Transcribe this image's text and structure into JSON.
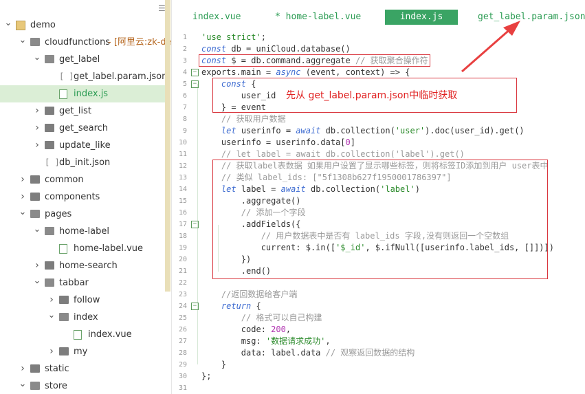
{
  "sidebar": {
    "menu_icon": "hamburger-icon",
    "items": [
      {
        "label": "demo",
        "type": "project",
        "depth": 0,
        "expanded": true
      },
      {
        "label": "cloudfunctions",
        "suffix": "- [阿里云:zk-dem",
        "type": "folder",
        "depth": 1,
        "expanded": true
      },
      {
        "label": "get_label",
        "type": "folder",
        "depth": 2,
        "expanded": true
      },
      {
        "label": "get_label.param.json",
        "type": "json",
        "depth": 3
      },
      {
        "label": "index.js",
        "type": "js",
        "depth": 3,
        "selected": true
      },
      {
        "label": "get_list",
        "type": "folder",
        "depth": 2,
        "expanded": false
      },
      {
        "label": "get_search",
        "type": "folder",
        "depth": 2,
        "expanded": false
      },
      {
        "label": "update_like",
        "type": "folder",
        "depth": 2,
        "expanded": false
      },
      {
        "label": "db_init.json",
        "type": "json",
        "depth": 2
      },
      {
        "label": "common",
        "type": "folder",
        "depth": 1,
        "expanded": false
      },
      {
        "label": "components",
        "type": "folder",
        "depth": 1,
        "expanded": false
      },
      {
        "label": "pages",
        "type": "folder",
        "depth": 1,
        "expanded": true
      },
      {
        "label": "home-label",
        "type": "folder",
        "depth": 2,
        "expanded": true
      },
      {
        "label": "home-label.vue",
        "type": "vue",
        "depth": 3
      },
      {
        "label": "home-search",
        "type": "folder",
        "depth": 2,
        "expanded": false
      },
      {
        "label": "tabbar",
        "type": "folder",
        "depth": 2,
        "expanded": true
      },
      {
        "label": "follow",
        "type": "folder",
        "depth": 3,
        "expanded": false
      },
      {
        "label": "index",
        "type": "folder",
        "depth": 3,
        "expanded": true
      },
      {
        "label": "index.vue",
        "type": "vue",
        "depth": 4
      },
      {
        "label": "my",
        "type": "folder",
        "depth": 3,
        "expanded": false
      },
      {
        "label": "static",
        "type": "folder",
        "depth": 1,
        "expanded": false
      },
      {
        "label": "store",
        "type": "folder",
        "depth": 1,
        "expanded": true
      }
    ]
  },
  "tabs": [
    {
      "label": "index.vue",
      "active": false
    },
    {
      "label": "* home-label.vue",
      "active": false
    },
    {
      "label": "index.js",
      "active": true
    },
    {
      "label": "get_label.param.json",
      "active": false
    }
  ],
  "editor": {
    "lines": [
      {
        "n": "1",
        "fold": null,
        "tokens": [
          [
            "s",
            "'use strict'"
          ],
          [
            "t",
            ";"
          ]
        ]
      },
      {
        "n": "2",
        "fold": null,
        "tokens": [
          [
            "k",
            "const"
          ],
          [
            "t",
            " db = uniCloud.database()"
          ]
        ]
      },
      {
        "n": "3",
        "fold": null,
        "tokens": [
          [
            "k",
            "const"
          ],
          [
            "t",
            " $ = db.command.aggregate "
          ],
          [
            "c",
            "// 获取聚合操作符"
          ]
        ]
      },
      {
        "n": "4",
        "fold": "-",
        "tokens": [
          [
            "t",
            "exports.main = "
          ],
          [
            "k",
            "async"
          ],
          [
            "t",
            " (event, context) => {"
          ]
        ]
      },
      {
        "n": "5",
        "fold": "-",
        "tokens": [
          [
            "t",
            "    "
          ],
          [
            "k",
            "const"
          ],
          [
            "t",
            " {"
          ]
        ]
      },
      {
        "n": "6",
        "fold": null,
        "tokens": [
          [
            "t",
            "        user_id"
          ]
        ]
      },
      {
        "n": "7",
        "fold": null,
        "tokens": [
          [
            "t",
            "    } = event"
          ]
        ]
      },
      {
        "n": "8",
        "fold": null,
        "tokens": [
          [
            "c",
            "    // 获取用户数据"
          ]
        ]
      },
      {
        "n": "9",
        "fold": null,
        "tokens": [
          [
            "t",
            "    "
          ],
          [
            "k",
            "let"
          ],
          [
            "t",
            " userinfo = "
          ],
          [
            "k",
            "await"
          ],
          [
            "t",
            " db.collection("
          ],
          [
            "s",
            "'user'"
          ],
          [
            "t",
            ").doc(user_id).get()"
          ]
        ]
      },
      {
        "n": "10",
        "fold": null,
        "tokens": [
          [
            "t",
            "    userinfo = userinfo.data["
          ],
          [
            "n",
            "0"
          ],
          [
            "t",
            "]"
          ]
        ]
      },
      {
        "n": "11",
        "fold": null,
        "tokens": [
          [
            "c",
            "    // let label = await db.collection('label').get()"
          ]
        ]
      },
      {
        "n": "12",
        "fold": null,
        "tokens": [
          [
            "c",
            "    // 获取label表数据 如果用户设置了显示哪些标签，则将标签ID添加到用户 user表中"
          ]
        ]
      },
      {
        "n": "13",
        "fold": null,
        "tokens": [
          [
            "c",
            "    // 类似 label_ids: [\"5f1308b627f1950001786397\"]"
          ]
        ]
      },
      {
        "n": "14",
        "fold": null,
        "tokens": [
          [
            "t",
            "    "
          ],
          [
            "k",
            "let"
          ],
          [
            "t",
            " label = "
          ],
          [
            "k",
            "await"
          ],
          [
            "t",
            " db.collection("
          ],
          [
            "s",
            "'label'"
          ],
          [
            "t",
            ")"
          ]
        ]
      },
      {
        "n": "15",
        "fold": null,
        "tokens": [
          [
            "t",
            "        .aggregate()"
          ]
        ]
      },
      {
        "n": "16",
        "fold": null,
        "tokens": [
          [
            "c",
            "        // 添加一个字段"
          ]
        ]
      },
      {
        "n": "17",
        "fold": "-",
        "tokens": [
          [
            "t",
            "        .addFields({"
          ]
        ]
      },
      {
        "n": "18",
        "fold": null,
        "tokens": [
          [
            "c",
            "            // 用户数据表中是否有 label_ids 字段,没有则返回一个空数组"
          ]
        ]
      },
      {
        "n": "19",
        "fold": null,
        "tokens": [
          [
            "t",
            "            current: $.in(["
          ],
          [
            "s",
            "'$_id'"
          ],
          [
            "t",
            ", $.ifNull([userinfo.label_ids, []])])"
          ]
        ]
      },
      {
        "n": "20",
        "fold": null,
        "tokens": [
          [
            "t",
            "        })"
          ]
        ]
      },
      {
        "n": "21",
        "fold": null,
        "tokens": [
          [
            "t",
            "        .end()"
          ]
        ]
      },
      {
        "n": "22",
        "fold": null,
        "tokens": [
          [
            "t",
            ""
          ]
        ]
      },
      {
        "n": "23",
        "fold": null,
        "tokens": [
          [
            "c",
            "    //返回数据给客户端"
          ]
        ]
      },
      {
        "n": "24",
        "fold": "-",
        "tokens": [
          [
            "t",
            "    "
          ],
          [
            "k",
            "return"
          ],
          [
            "t",
            " {"
          ]
        ]
      },
      {
        "n": "25",
        "fold": null,
        "tokens": [
          [
            "c",
            "        // 格式可以自己构建"
          ]
        ]
      },
      {
        "n": "26",
        "fold": null,
        "tokens": [
          [
            "t",
            "        code: "
          ],
          [
            "n",
            "200"
          ],
          [
            "t",
            ","
          ]
        ]
      },
      {
        "n": "27",
        "fold": null,
        "tokens": [
          [
            "t",
            "        msg: "
          ],
          [
            "s",
            "'数据请求成功'"
          ],
          [
            "t",
            ","
          ]
        ]
      },
      {
        "n": "28",
        "fold": null,
        "tokens": [
          [
            "t",
            "        data: label.data "
          ],
          [
            "c",
            "// 观察返回数据的结构"
          ]
        ]
      },
      {
        "n": "29",
        "fold": null,
        "tokens": [
          [
            "t",
            "    }"
          ]
        ]
      },
      {
        "n": "30",
        "fold": null,
        "tokens": [
          [
            "t",
            "};"
          ]
        ]
      },
      {
        "n": "31",
        "fold": null,
        "tokens": [
          [
            "t",
            ""
          ]
        ]
      }
    ]
  },
  "annotation": {
    "text": "先从 get_label.param.json中临时获取",
    "color": "#e02020"
  }
}
